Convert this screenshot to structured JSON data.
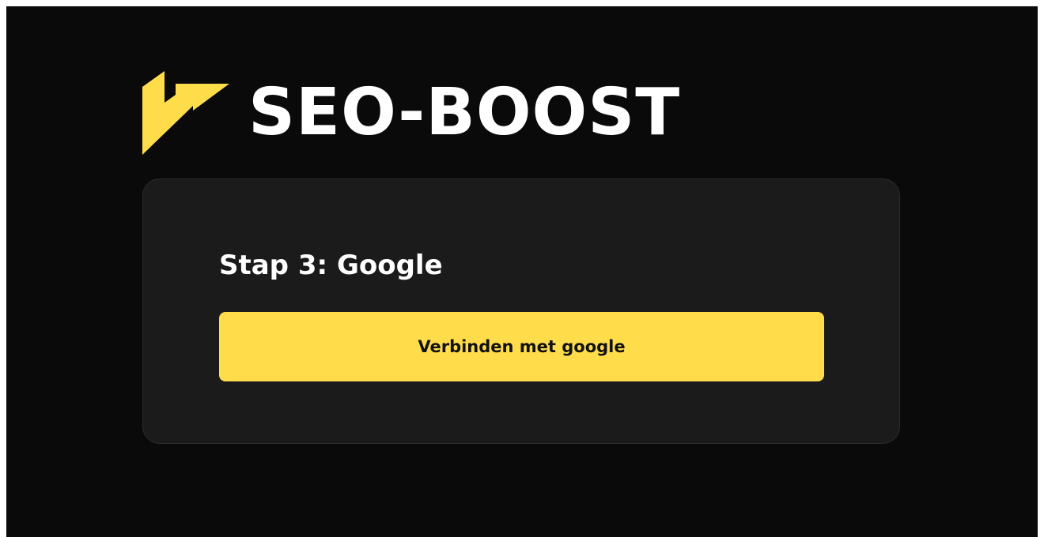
{
  "brand": {
    "name": "SEO-BOOST",
    "logo_icon": "lightning-bolt-icon",
    "accent_color": "#ffdd4a"
  },
  "card": {
    "title": "Stap 3: Google",
    "button_label": "Verbinden met google"
  },
  "colors": {
    "page_background": "#0a0a0a",
    "card_background": "#1b1b1b",
    "text": "#ffffff",
    "button_text": "#111111"
  }
}
